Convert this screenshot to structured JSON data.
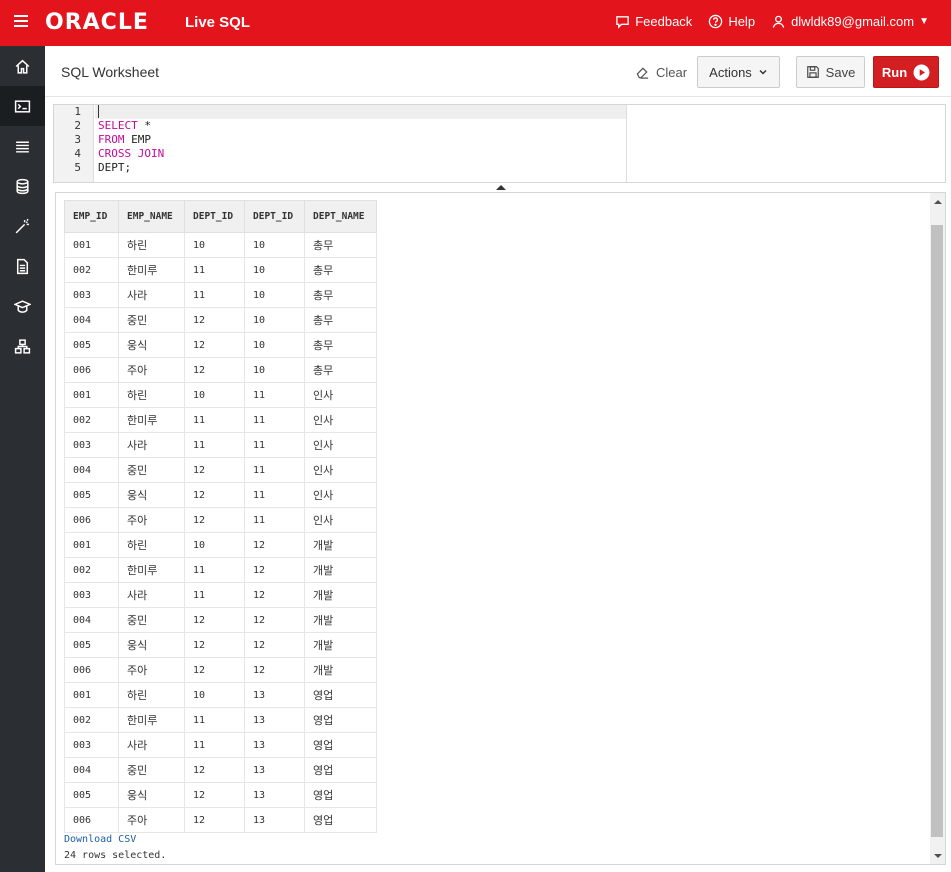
{
  "topbar": {
    "brand": "ORACLE",
    "product": "Live SQL",
    "feedback": "Feedback",
    "help": "Help",
    "user": "dlwldk89@gmail.com"
  },
  "sidebar": {
    "items": [
      "home-icon",
      "sql-worksheet-icon",
      "list-icon",
      "database-icon",
      "magic-wand-icon",
      "document-icon",
      "graduation-cap-icon",
      "schema-icon"
    ],
    "active": 1
  },
  "worksheet": {
    "title": "SQL Worksheet",
    "clear_label": "Clear",
    "actions_label": "Actions",
    "save_label": "Save",
    "run_label": "Run"
  },
  "editor": {
    "line_numbers": [
      "1",
      "2",
      "3",
      "4",
      "5"
    ],
    "lines": [
      {
        "kw": "",
        "text": ""
      },
      {
        "kw": "SELECT",
        "text": " *"
      },
      {
        "kw": "FROM",
        "text": " EMP"
      },
      {
        "kw": "CROSS JOIN",
        "text": ""
      },
      {
        "kw": "",
        "text": "DEPT;"
      }
    ]
  },
  "results": {
    "columns": [
      "EMP_ID",
      "EMP_NAME",
      "DEPT_ID",
      "DEPT_ID",
      "DEPT_NAME"
    ],
    "rows": [
      [
        "001",
        "하린",
        "10",
        "10",
        "총무"
      ],
      [
        "002",
        "한미루",
        "11",
        "10",
        "총무"
      ],
      [
        "003",
        "사라",
        "11",
        "10",
        "총무"
      ],
      [
        "004",
        "중민",
        "12",
        "10",
        "총무"
      ],
      [
        "005",
        "웅식",
        "12",
        "10",
        "총무"
      ],
      [
        "006",
        "주아",
        "12",
        "10",
        "총무"
      ],
      [
        "001",
        "하린",
        "10",
        "11",
        "인사"
      ],
      [
        "002",
        "한미루",
        "11",
        "11",
        "인사"
      ],
      [
        "003",
        "사라",
        "11",
        "11",
        "인사"
      ],
      [
        "004",
        "중민",
        "12",
        "11",
        "인사"
      ],
      [
        "005",
        "웅식",
        "12",
        "11",
        "인사"
      ],
      [
        "006",
        "주아",
        "12",
        "11",
        "인사"
      ],
      [
        "001",
        "하린",
        "10",
        "12",
        "개발"
      ],
      [
        "002",
        "한미루",
        "11",
        "12",
        "개발"
      ],
      [
        "003",
        "사라",
        "11",
        "12",
        "개발"
      ],
      [
        "004",
        "중민",
        "12",
        "12",
        "개발"
      ],
      [
        "005",
        "웅식",
        "12",
        "12",
        "개발"
      ],
      [
        "006",
        "주아",
        "12",
        "12",
        "개발"
      ],
      [
        "001",
        "하린",
        "10",
        "13",
        "영업"
      ],
      [
        "002",
        "한미루",
        "11",
        "13",
        "영업"
      ],
      [
        "003",
        "사라",
        "11",
        "13",
        "영업"
      ],
      [
        "004",
        "중민",
        "12",
        "13",
        "영업"
      ],
      [
        "005",
        "웅식",
        "12",
        "13",
        "영업"
      ],
      [
        "006",
        "주아",
        "12",
        "13",
        "영업"
      ]
    ],
    "download_label": "Download CSV",
    "status": "24 rows selected."
  },
  "colors": {
    "brand_red": "#e3141b",
    "sidebar_bg": "#2b2f33",
    "keyword": "#c5089c"
  }
}
